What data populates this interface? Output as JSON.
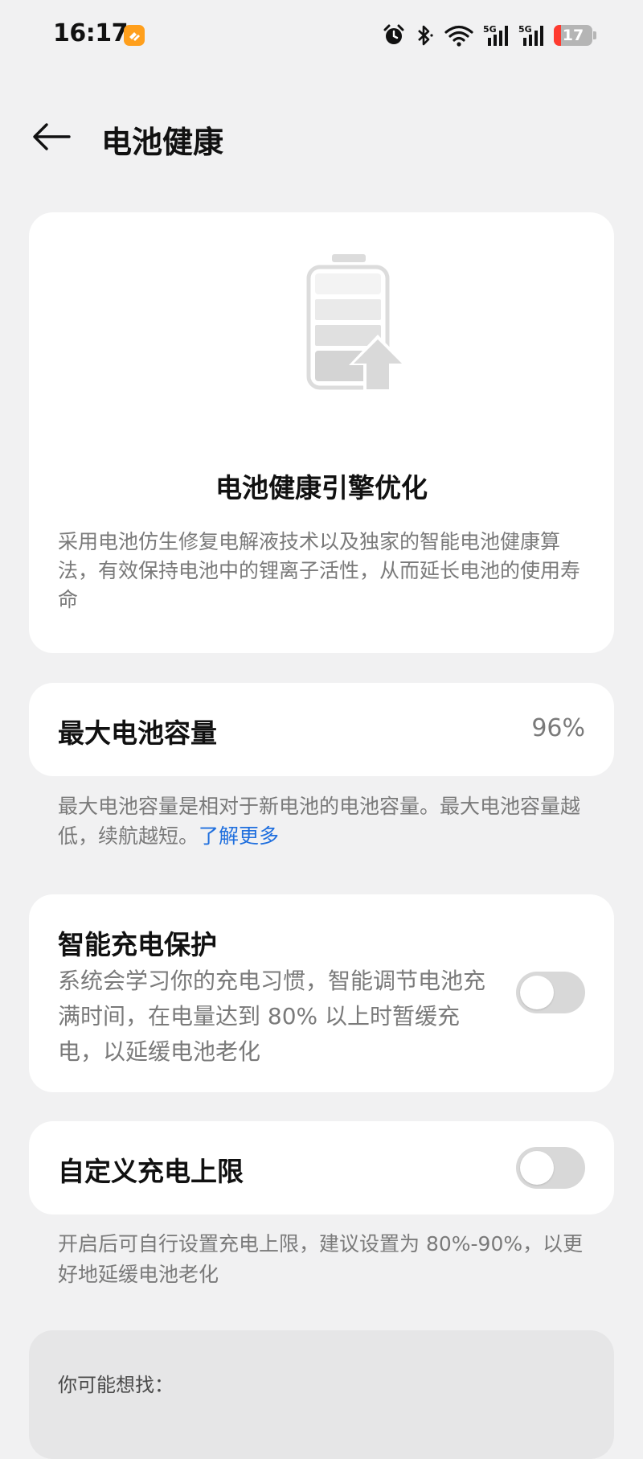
{
  "status_bar": {
    "time": "16:17",
    "battery_level": "17",
    "icons": [
      "app-notification-icon",
      "alarm-icon",
      "bluetooth-icon",
      "wifi-icon",
      "signal-5g-icon",
      "signal-5g-icon",
      "battery-icon"
    ],
    "network_label_1": "5G",
    "network_label_2": "5G"
  },
  "header": {
    "title": "电池健康",
    "back_icon": "back-arrow-icon"
  },
  "engine_card": {
    "illustration_icon": "battery-upgrade-icon",
    "title": "电池健康引擎优化",
    "description": "采用电池仿生修复电解液技术以及独家的智能电池健康算法，有效保持电池中的锂离子活性，从而延长电池的使用寿命"
  },
  "capacity": {
    "label": "最大电池容量",
    "value": "96%",
    "note": "最大电池容量是相对于新电池的电池容量。最大电池容量越低，续航越短。",
    "learn_more": "了解更多"
  },
  "smart_charging": {
    "title": "智能充电保护",
    "description": "系统会学习你的充电习惯，智能调节电池充满时间，在电量达到 80% 以上时暂缓充电，以延缓电池老化",
    "enabled": false
  },
  "custom_limit": {
    "label": "自定义充电上限",
    "note": "开启后可自行设置充电上限，建议设置为 80%-90%，以更好地延缓电池老化",
    "enabled": false
  },
  "suggestions": {
    "title": "你可能想找："
  },
  "colors": {
    "background": "#f1f1f2",
    "card": "#ffffff",
    "link": "#1f6fde",
    "toggle_off": "#d8d8d8",
    "battery_low": "#ff3b30",
    "app_badge": "#ff9f1c"
  }
}
